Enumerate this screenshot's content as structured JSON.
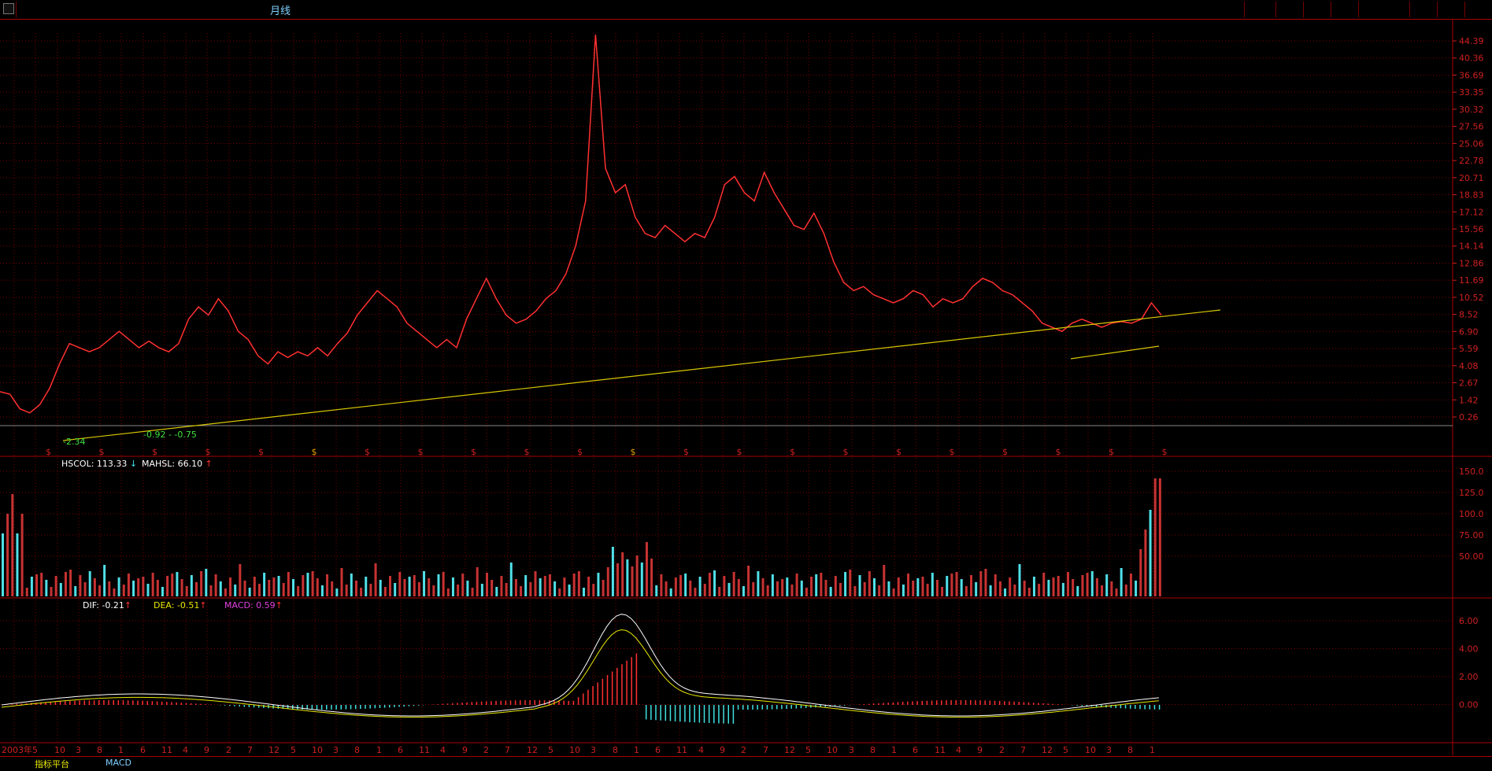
{
  "window": {
    "title": "月线"
  },
  "main": {
    "y_ticks": [
      "44.39",
      "40.36",
      "36.69",
      "33.35",
      "30.32",
      "27.56",
      "25.06",
      "22.78",
      "20.71",
      "18.83",
      "17.12",
      "15.56",
      "14.14",
      "12.86",
      "11.69",
      "10.52",
      "8.52",
      "6.90",
      "5.59",
      "4.08",
      "2.67",
      "1.42",
      "0.26"
    ],
    "annotations": [
      "-2.34",
      "-0.92",
      "-0.75"
    ],
    "dividend_marker": "$"
  },
  "volume": {
    "legend": [
      {
        "text": "HSCOL: 113.33",
        "arrow": "↓",
        "color": "#ffffff"
      },
      {
        "text": "MAHSL: 66.10",
        "arrow": "↑",
        "color": "#ffffff"
      }
    ],
    "y_ticks": [
      "150.0",
      "125.0",
      "100.0",
      "75.00",
      "50.00"
    ]
  },
  "macd": {
    "legend": [
      {
        "text": "DIF: -0.21",
        "arrow": "↑",
        "color": "#ffffff"
      },
      {
        "text": "DEA: -0.51",
        "arrow": "↑",
        "color": "#e8e800"
      },
      {
        "text": "MACD: 0.59",
        "arrow": "↑",
        "color": "#e040e0"
      }
    ],
    "y_ticks": [
      "6.00",
      "4.00",
      "2.00",
      "0.00"
    ]
  },
  "time_axis": {
    "labels": [
      "2003年",
      "5",
      "10",
      "3",
      "8",
      "1",
      "6",
      "11",
      "4",
      "9",
      "2",
      "7",
      "12",
      "5",
      "10",
      "3",
      "8",
      "1",
      "6",
      "11",
      "4",
      "9",
      "2",
      "7",
      "12",
      "5",
      "10",
      "3",
      "8",
      "1",
      "6",
      "11",
      "4",
      "9",
      "2",
      "7",
      "12",
      "5",
      "10",
      "3",
      "8",
      "1",
      "6",
      "11",
      "4",
      "9",
      "2",
      "7",
      "12",
      "5",
      "10",
      "3",
      "8",
      "1"
    ]
  },
  "bottom_tabs": {
    "platform": "指标平台",
    "macd": "MACD"
  },
  "colors": {
    "grid": "#7a0000",
    "price": "#ff3030",
    "trend": "#d8c800",
    "vol_up": "#c83232",
    "vol_down": "#50e0e8",
    "axis": "#d02020"
  },
  "chart_data": {
    "type": "line",
    "title": "月线",
    "price_series_approx": [
      0.6,
      0.3,
      -1.5,
      -2.0,
      -1.0,
      1.0,
      4.0,
      6.5,
      6.0,
      5.5,
      6.0,
      7.0,
      8.0,
      7.0,
      6.0,
      6.8,
      6.0,
      5.5,
      6.5,
      9.5,
      11.0,
      10.0,
      12.0,
      10.5,
      8.0,
      7.0,
      5.0,
      4.0,
      5.5,
      4.8,
      5.5,
      5.0,
      6.0,
      5.0,
      6.5,
      7.8,
      10.0,
      11.5,
      13.0,
      12.0,
      11.0,
      9.0,
      8.0,
      7.0,
      6.0,
      7.0,
      6.0,
      9.5,
      12.0,
      14.5,
      12.0,
      10.0,
      9.0,
      9.5,
      10.5,
      12.0,
      13.0,
      15.0,
      18.5,
      24.0,
      44.4,
      28.0,
      25.0,
      26.0,
      22.0,
      20.0,
      19.5,
      21.0,
      20.0,
      19.0,
      20.0,
      19.5,
      22.0,
      26.0,
      27.0,
      25.0,
      24.0,
      27.5,
      25.0,
      23.0,
      21.0,
      20.5,
      22.5,
      20.0,
      16.5,
      14.0,
      13.0,
      13.5,
      12.5,
      12.0,
      11.5,
      12.0,
      13.0,
      12.5,
      11.0,
      12.0,
      11.5,
      12.0,
      13.5,
      14.5,
      14.0,
      13.0,
      12.5,
      11.5,
      10.5,
      9.0,
      8.5,
      8.0,
      9.0,
      9.5,
      9.0,
      8.5,
      9.0,
      9.2,
      9.0,
      9.5,
      11.5,
      10.0
    ]
  }
}
